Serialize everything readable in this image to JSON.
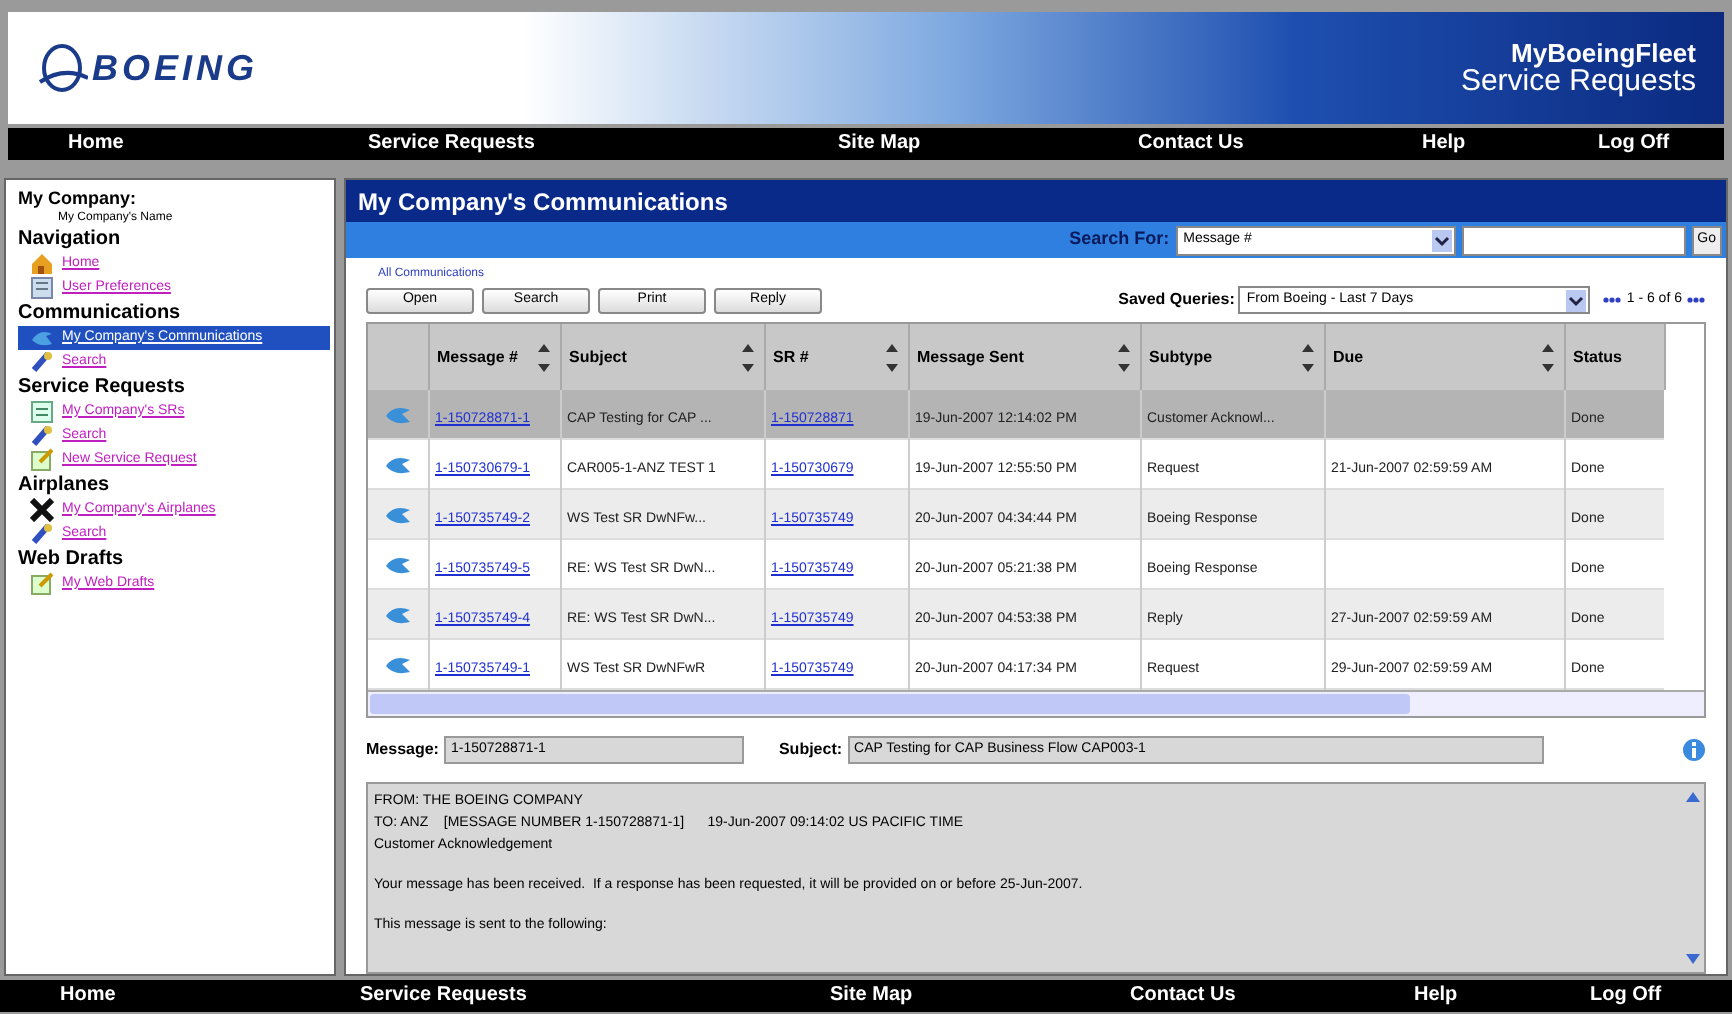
{
  "header": {
    "logo": "BOEING",
    "product": "MyBoeingFleet",
    "app": "Service Requests"
  },
  "nav": [
    "Home",
    "Service Requests",
    "Site Map",
    "Contact Us",
    "Help",
    "Log Off"
  ],
  "footer_nav": [
    "Home",
    "Service Requests",
    "Site Map",
    "Contact Us",
    "Help",
    "Log Off"
  ],
  "sidebar": {
    "company_label": "My Company:",
    "company_name": "My Company's Name",
    "sections": [
      {
        "title": "Navigation",
        "items": [
          {
            "label": "Home",
            "kind": "home",
            "selected": false
          },
          {
            "label": "User Preferences",
            "kind": "prefs",
            "selected": false
          }
        ]
      },
      {
        "title": "Communications",
        "items": [
          {
            "label": "My Company's Communications",
            "kind": "comms",
            "selected": true
          },
          {
            "label": "Search",
            "kind": "search",
            "selected": false
          }
        ]
      },
      {
        "title": "Service Requests",
        "items": [
          {
            "label": "My Company's SRs",
            "kind": "list",
            "selected": false
          },
          {
            "label": "Search",
            "kind": "search",
            "selected": false
          },
          {
            "label": "New Service Request",
            "kind": "new",
            "selected": false
          }
        ]
      },
      {
        "title": "Airplanes",
        "items": [
          {
            "label": "My Company's Airplanes",
            "kind": "airplane",
            "selected": false
          },
          {
            "label": "Search",
            "kind": "search",
            "selected": false
          }
        ]
      },
      {
        "title": "Web Drafts",
        "items": [
          {
            "label": "My Web Drafts",
            "kind": "new",
            "selected": false
          }
        ]
      }
    ]
  },
  "main": {
    "title": "My Company's Communications",
    "search": {
      "label": "Search For:",
      "field": "Message #",
      "button": "Go"
    },
    "group_label": "All Communications",
    "buttons": [
      "Open",
      "Search",
      "Print",
      "Reply"
    ],
    "saved_queries": {
      "label": "Saved Queries:",
      "value": "From Boeing - Last 7 Days"
    },
    "pager": "1 - 6 of 6",
    "table": {
      "columns": [
        {
          "label": "Message #",
          "sortable": true
        },
        {
          "label": "Subject",
          "sortable": true
        },
        {
          "label": "SR #",
          "sortable": true
        },
        {
          "label": "Message Sent",
          "sortable": true
        },
        {
          "label": "Subtype",
          "sortable": true
        },
        {
          "label": "Due",
          "sortable": true
        },
        {
          "label": "Status",
          "sortable": false
        }
      ],
      "rows": [
        {
          "selected": true,
          "cells": [
            "1-150728871-1",
            "CAP Testing for CAP ...",
            "1-150728871",
            "19-Jun-2007 12:14:02 PM",
            "Customer Acknowl...",
            null,
            "Done"
          ]
        },
        {
          "selected": false,
          "cells": [
            "1-150730679-1",
            "CAR005-1-ANZ TEST 1",
            "1-150730679",
            "19-Jun-2007 12:55:50 PM",
            "Request",
            "21-Jun-2007 02:59:59 AM",
            "Done"
          ]
        },
        {
          "selected": false,
          "cells": [
            "1-150735749-2",
            "WS Test SR DwNFw...",
            "1-150735749",
            "20-Jun-2007 04:34:44 PM",
            "Boeing Response",
            null,
            "Done"
          ]
        },
        {
          "selected": false,
          "cells": [
            "1-150735749-5",
            "RE: WS Test SR DwN...",
            "1-150735749",
            "20-Jun-2007 05:21:38 PM",
            "Boeing Response",
            null,
            "Done"
          ]
        },
        {
          "selected": false,
          "cells": [
            "1-150735749-4",
            "RE: WS Test SR DwN...",
            "1-150735749",
            "20-Jun-2007 04:53:38 PM",
            "Reply",
            "27-Jun-2007 02:59:59 AM",
            "Done"
          ]
        },
        {
          "selected": false,
          "cells": [
            "1-150735749-1",
            "WS Test SR DwNFwR",
            "1-150735749",
            "20-Jun-2007 04:17:34 PM",
            "Request",
            "29-Jun-2007 02:59:59 AM",
            "Done"
          ]
        }
      ]
    },
    "detail": {
      "message_label": "Message:",
      "message": "1-150728871-1",
      "subject_label": "Subject:",
      "subject": "CAP Testing for CAP Business Flow CAP003-1",
      "body": [
        [
          "FROM: THE BOEING COMPANY",
          "TO: ANZ    [MESSAGE NUMBER 1-150728871-1]      19-Jun-2007 09:14:02 US PACIFIC TIME",
          "Customer Acknowledgement"
        ],
        [
          "Your message has been received.  If a response has been requested, it will be provided on or before 25-Jun-2007."
        ],
        [
          "This message is sent to the following:"
        ]
      ]
    }
  }
}
